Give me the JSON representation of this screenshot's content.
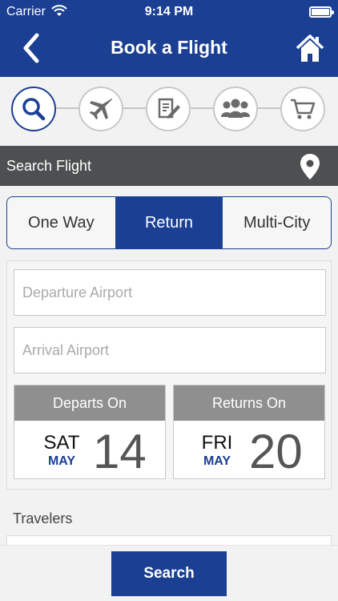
{
  "status_bar": {
    "carrier": "Carrier",
    "time": "9:14 PM"
  },
  "header": {
    "title": "Book a Flight",
    "back_icon": "chevron-left-icon",
    "home_icon": "home-icon"
  },
  "steps": [
    {
      "icon": "search-icon",
      "active": true
    },
    {
      "icon": "airplane-icon",
      "active": false
    },
    {
      "icon": "document-edit-icon",
      "active": false
    },
    {
      "icon": "group-icon",
      "active": false
    },
    {
      "icon": "cart-icon",
      "active": false
    }
  ],
  "section": {
    "label": "Search Flight",
    "icon": "location-pin-icon"
  },
  "trip_type": {
    "options": [
      "One Way",
      "Return",
      "Multi-City"
    ],
    "selected": "Return"
  },
  "form": {
    "departure": {
      "placeholder": "Departure Airport",
      "value": ""
    },
    "arrival": {
      "placeholder": "Arrival Airport",
      "value": ""
    },
    "departs_on": {
      "label": "Departs On",
      "day": "SAT",
      "month": "MAY",
      "date": "14"
    },
    "returns_on": {
      "label": "Returns On",
      "day": "FRI",
      "month": "MAY",
      "date": "20"
    },
    "travelers_label": "Travelers"
  },
  "actions": {
    "search_label": "Search"
  },
  "colors": {
    "primary": "#1b3f93",
    "section_bg": "#4d4f50",
    "date_header": "#8f8f8f"
  }
}
